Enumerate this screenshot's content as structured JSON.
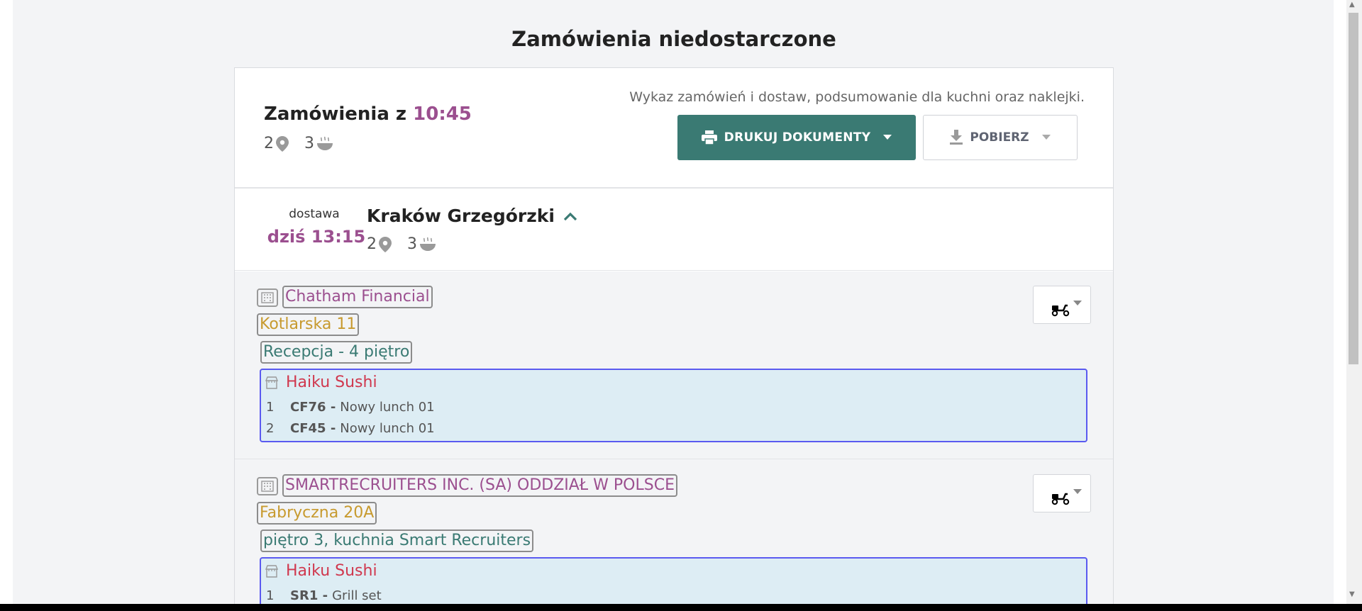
{
  "page": {
    "title": "Zamówienia niedostarczone"
  },
  "order_batch": {
    "title_prefix": "Zamówienia z",
    "time": "10:45",
    "locations_count": "2",
    "meals_count": "3",
    "summary_text": "Wykaz zamówień i dostaw, podsumowanie dla kuchni oraz naklejki.",
    "print_button_label": "DRUKUJ DOKUMENTY",
    "download_button_label": "POBIERZ"
  },
  "delivery": {
    "kind": "dostawa",
    "when": "dziś 13:15",
    "place": "Kraków Grzegórzki",
    "locations_count": "2",
    "meals_count": "3"
  },
  "customers": [
    {
      "company": "Chatham Financial",
      "street": "Kotlarska 11",
      "location": "Recepcja - 4 piętro",
      "restaurant": "Haiku Sushi",
      "items": [
        {
          "qty": "1",
          "code": "CF76 -",
          "name": "Nowy lunch 01"
        },
        {
          "qty": "2",
          "code": "CF45 -",
          "name": "Nowy lunch 01"
        }
      ]
    },
    {
      "company": "SMARTRECRUITERS INC. (SA) ODDZIAŁ W POLSCE",
      "street": "Fabryczna 20A",
      "location": "piętro 3, kuchnia Smart Recruiters",
      "restaurant": "Haiku Sushi",
      "items": [
        {
          "qty": "1",
          "code": "SR1 -",
          "name": "Grill set"
        }
      ]
    }
  ],
  "colors": {
    "accent_purple": "#9b4f8f",
    "primary_teal": "#3a7a73",
    "street_gold": "#c79a2f",
    "restaurant_red": "#d0384e",
    "restaurant_box_bg": "#ddedf4",
    "restaurant_box_border": "#5a5af0"
  },
  "icons": [
    "map-pin-icon",
    "food-bowl-icon",
    "printer-icon",
    "download-icon",
    "chevron-up-icon",
    "building-icon",
    "store-icon",
    "scooter-icon",
    "caret-down-icon"
  ]
}
